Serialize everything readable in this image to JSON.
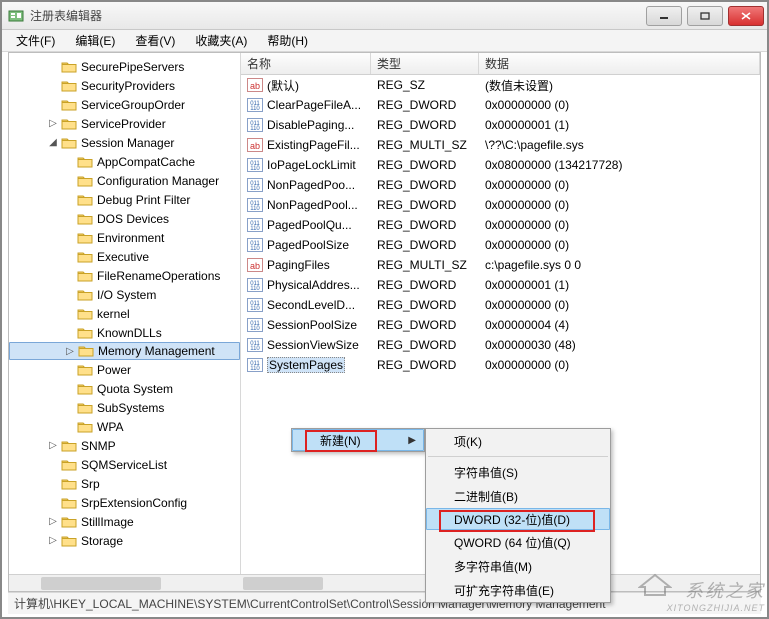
{
  "window": {
    "title": "注册表编辑器"
  },
  "menu": {
    "file": "文件(F)",
    "edit": "编辑(E)",
    "view": "查看(V)",
    "fav": "收藏夹(A)",
    "help": "帮助(H)"
  },
  "tree": [
    {
      "depth": 2,
      "arrow": "",
      "label": "SecurePipeServers"
    },
    {
      "depth": 2,
      "arrow": "",
      "label": "SecurityProviders"
    },
    {
      "depth": 2,
      "arrow": "",
      "label": "ServiceGroupOrder"
    },
    {
      "depth": 2,
      "arrow": "▷",
      "label": "ServiceProvider"
    },
    {
      "depth": 2,
      "arrow": "◢",
      "label": "Session Manager"
    },
    {
      "depth": 3,
      "arrow": "",
      "label": "AppCompatCache"
    },
    {
      "depth": 3,
      "arrow": "",
      "label": "Configuration Manager"
    },
    {
      "depth": 3,
      "arrow": "",
      "label": "Debug Print Filter"
    },
    {
      "depth": 3,
      "arrow": "",
      "label": "DOS Devices"
    },
    {
      "depth": 3,
      "arrow": "",
      "label": "Environment"
    },
    {
      "depth": 3,
      "arrow": "",
      "label": "Executive"
    },
    {
      "depth": 3,
      "arrow": "",
      "label": "FileRenameOperations"
    },
    {
      "depth": 3,
      "arrow": "",
      "label": "I/O System"
    },
    {
      "depth": 3,
      "arrow": "",
      "label": "kernel"
    },
    {
      "depth": 3,
      "arrow": "",
      "label": "KnownDLLs"
    },
    {
      "depth": 3,
      "arrow": "▷",
      "label": "Memory Management",
      "selected": true
    },
    {
      "depth": 3,
      "arrow": "",
      "label": "Power"
    },
    {
      "depth": 3,
      "arrow": "",
      "label": "Quota System"
    },
    {
      "depth": 3,
      "arrow": "",
      "label": "SubSystems"
    },
    {
      "depth": 3,
      "arrow": "",
      "label": "WPA"
    },
    {
      "depth": 2,
      "arrow": "▷",
      "label": "SNMP"
    },
    {
      "depth": 2,
      "arrow": "",
      "label": "SQMServiceList"
    },
    {
      "depth": 2,
      "arrow": "",
      "label": "Srp"
    },
    {
      "depth": 2,
      "arrow": "",
      "label": "SrpExtensionConfig"
    },
    {
      "depth": 2,
      "arrow": "▷",
      "label": "StillImage"
    },
    {
      "depth": 2,
      "arrow": "▷",
      "label": "Storage"
    }
  ],
  "list": {
    "headers": {
      "name": "名称",
      "type": "类型",
      "data": "数据"
    },
    "rows": [
      {
        "icon": "str",
        "name": "(默认)",
        "type": "REG_SZ",
        "data": "(数值未设置)"
      },
      {
        "icon": "bin",
        "name": "ClearPageFileA...",
        "type": "REG_DWORD",
        "data": "0x00000000 (0)"
      },
      {
        "icon": "bin",
        "name": "DisablePaging...",
        "type": "REG_DWORD",
        "data": "0x00000001 (1)"
      },
      {
        "icon": "str",
        "name": "ExistingPageFil...",
        "type": "REG_MULTI_SZ",
        "data": "\\??\\C:\\pagefile.sys"
      },
      {
        "icon": "bin",
        "name": "IoPageLockLimit",
        "type": "REG_DWORD",
        "data": "0x08000000 (134217728)"
      },
      {
        "icon": "bin",
        "name": "NonPagedPoo...",
        "type": "REG_DWORD",
        "data": "0x00000000 (0)"
      },
      {
        "icon": "bin",
        "name": "NonPagedPool...",
        "type": "REG_DWORD",
        "data": "0x00000000 (0)"
      },
      {
        "icon": "bin",
        "name": "PagedPoolQu...",
        "type": "REG_DWORD",
        "data": "0x00000000 (0)"
      },
      {
        "icon": "bin",
        "name": "PagedPoolSize",
        "type": "REG_DWORD",
        "data": "0x00000000 (0)"
      },
      {
        "icon": "str",
        "name": "PagingFiles",
        "type": "REG_MULTI_SZ",
        "data": "c:\\pagefile.sys 0 0"
      },
      {
        "icon": "bin",
        "name": "PhysicalAddres...",
        "type": "REG_DWORD",
        "data": "0x00000001 (1)"
      },
      {
        "icon": "bin",
        "name": "SecondLevelD...",
        "type": "REG_DWORD",
        "data": "0x00000000 (0)"
      },
      {
        "icon": "bin",
        "name": "SessionPoolSize",
        "type": "REG_DWORD",
        "data": "0x00000004 (4)"
      },
      {
        "icon": "bin",
        "name": "SessionViewSize",
        "type": "REG_DWORD",
        "data": "0x00000030 (48)"
      },
      {
        "icon": "bin",
        "name": "SystemPages",
        "type": "REG_DWORD",
        "data": "0x00000000 (0)",
        "selected": true
      }
    ]
  },
  "context": {
    "parent": {
      "label": "新建(N)"
    },
    "sub": [
      {
        "label": "项(K)"
      },
      {
        "divider": true
      },
      {
        "label": "字符串值(S)"
      },
      {
        "label": "二进制值(B)"
      },
      {
        "label": "DWORD (32-位)值(D)",
        "highlight": true
      },
      {
        "label": "QWORD (64 位)值(Q)"
      },
      {
        "label": "多字符串值(M)"
      },
      {
        "label": "可扩充字符串值(E)"
      }
    ]
  },
  "status": {
    "path": "计算机\\HKEY_LOCAL_MACHINE\\SYSTEM\\CurrentControlSet\\Control\\Session Manager\\Memory Management"
  },
  "watermark": {
    "text": "系统之家",
    "sub": "XITONGZHIJIA.NET"
  }
}
